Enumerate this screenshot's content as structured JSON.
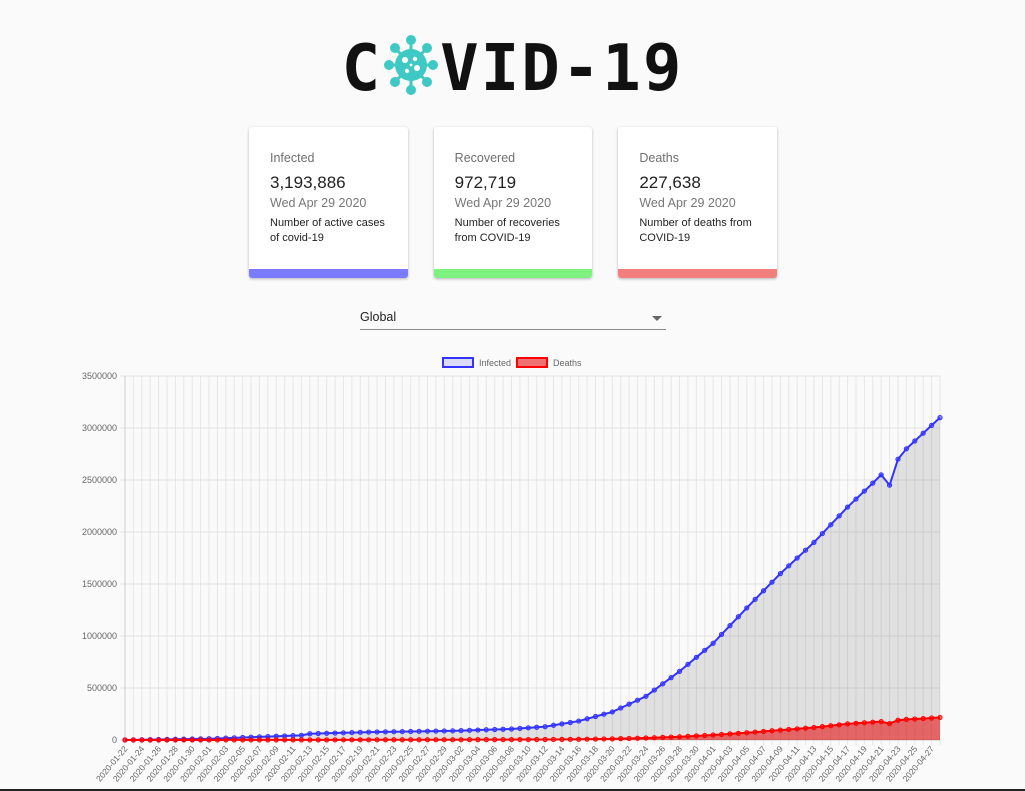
{
  "logo": {
    "text_left": "C",
    "text_right": "VID-19",
    "icon": "virus-icon"
  },
  "cards": [
    {
      "title": "Infected",
      "value": "3,193,886",
      "date": "Wed Apr 29 2020",
      "desc_line1": "Number of active cases",
      "desc_line2": "of covid-19",
      "color": "#7b7bff"
    },
    {
      "title": "Recovered",
      "value": "972,719",
      "date": "Wed Apr 29 2020",
      "desc_line1": "Number of recoveries",
      "desc_line2": "from COVID-19",
      "color": "#7ef27e"
    },
    {
      "title": "Deaths",
      "value": "227,638",
      "date": "Wed Apr 29 2020",
      "desc_line1": "Number of deaths from",
      "desc_line2": "COVID-19",
      "color": "#f27e7e"
    }
  ],
  "country_select": {
    "value": "Global"
  },
  "chart_data": {
    "type": "line",
    "legend_position": "top",
    "ylim": [
      0,
      3500000
    ],
    "yticks": [
      0,
      500000,
      1000000,
      1500000,
      2000000,
      2500000,
      3000000,
      3500000
    ],
    "x_start": "2020-01-22",
    "x_end": "2020-04-28",
    "grid": true,
    "series": [
      {
        "name": "Infected",
        "color": "#3333ff",
        "fill": "rgba(0,0,0,0.1)",
        "keyframes": [
          [
            "2020-01-22",
            555
          ],
          [
            "2020-02-01",
            12000
          ],
          [
            "2020-02-12",
            45000
          ],
          [
            "2020-02-13",
            60000
          ],
          [
            "2020-02-20",
            76000
          ],
          [
            "2020-03-01",
            88000
          ],
          [
            "2020-03-08",
            106000
          ],
          [
            "2020-03-12",
            128000
          ],
          [
            "2020-03-16",
            182000
          ],
          [
            "2020-03-20",
            270000
          ],
          [
            "2020-03-24",
            420000
          ],
          [
            "2020-03-28",
            660000
          ],
          [
            "2020-04-01",
            930000
          ],
          [
            "2020-04-05",
            1270000
          ],
          [
            "2020-04-09",
            1600000
          ],
          [
            "2020-04-13",
            1900000
          ],
          [
            "2020-04-17",
            2240000
          ],
          [
            "2020-04-20",
            2470000
          ],
          [
            "2020-04-21",
            2550000
          ],
          [
            "2020-04-22",
            2450000
          ],
          [
            "2020-04-23",
            2700000
          ],
          [
            "2020-04-24",
            2800000
          ],
          [
            "2020-04-26",
            2950000
          ],
          [
            "2020-04-28",
            3100000
          ]
        ]
      },
      {
        "name": "Deaths",
        "color": "#ff0000",
        "fill": "rgba(230,0,0,0.55)",
        "keyframes": [
          [
            "2020-01-22",
            17
          ],
          [
            "2020-02-12",
            1100
          ],
          [
            "2020-03-01",
            3000
          ],
          [
            "2020-03-12",
            4700
          ],
          [
            "2020-03-16",
            7000
          ],
          [
            "2020-03-20",
            11000
          ],
          [
            "2020-03-24",
            19000
          ],
          [
            "2020-03-28",
            31000
          ],
          [
            "2020-04-01",
            48000
          ],
          [
            "2020-04-05",
            70000
          ],
          [
            "2020-04-09",
            95000
          ],
          [
            "2020-04-13",
            120000
          ],
          [
            "2020-04-17",
            155000
          ],
          [
            "2020-04-21",
            177000
          ],
          [
            "2020-04-22",
            158000
          ],
          [
            "2020-04-23",
            190000
          ],
          [
            "2020-04-24",
            198000
          ],
          [
            "2020-04-26",
            206000
          ],
          [
            "2020-04-28",
            217000
          ]
        ]
      }
    ]
  }
}
